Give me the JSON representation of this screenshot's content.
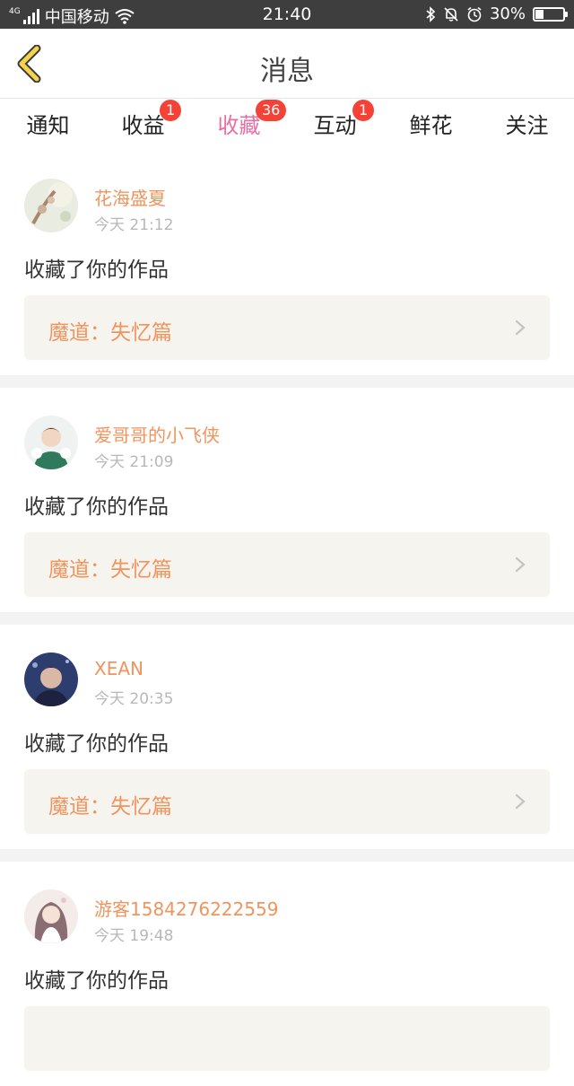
{
  "status_bar": {
    "network": "4G",
    "carrier": "中国移动",
    "time": "21:40",
    "battery": "30%",
    "battery_level": 0.3,
    "icons": [
      "signal-icon",
      "wifi-icon",
      "bluetooth-icon",
      "mute-bell-icon",
      "alarm-icon",
      "battery-icon"
    ]
  },
  "header": {
    "title": "消息",
    "back_icon": "chevron-left-icon"
  },
  "tabs": [
    {
      "label": "通知",
      "badge": null,
      "active": false
    },
    {
      "label": "收益",
      "badge": "1",
      "active": false
    },
    {
      "label": "收藏",
      "badge": "36",
      "active": true
    },
    {
      "label": "互动",
      "badge": "1",
      "active": false
    },
    {
      "label": "鲜花",
      "badge": null,
      "active": false
    },
    {
      "label": "关注",
      "badge": null,
      "active": false
    }
  ],
  "items": [
    {
      "user": "花海盛夏",
      "time": "今天 21:12",
      "action": "收藏了你的作品",
      "work": "魔道：失忆篇"
    },
    {
      "user": "爱哥哥的小飞侠",
      "time": "今天 21:09",
      "action": "收藏了你的作品",
      "work": "魔道：失忆篇"
    },
    {
      "user": "XEAN",
      "time": "今天 20:35",
      "action": "收藏了你的作品",
      "work": "魔道：失忆篇"
    },
    {
      "user": "游客1584276222559",
      "time": "今天 19:48",
      "action": "收藏了你的作品",
      "work": ""
    }
  ],
  "colors": {
    "accent_pink": "#e76fa2",
    "name_orange": "#f0945e",
    "badge_red": "#f44336",
    "back_yellow": "#f3d34a",
    "card_bg": "#f5f4ee",
    "status_bar_bg": "#3e3e3e"
  }
}
